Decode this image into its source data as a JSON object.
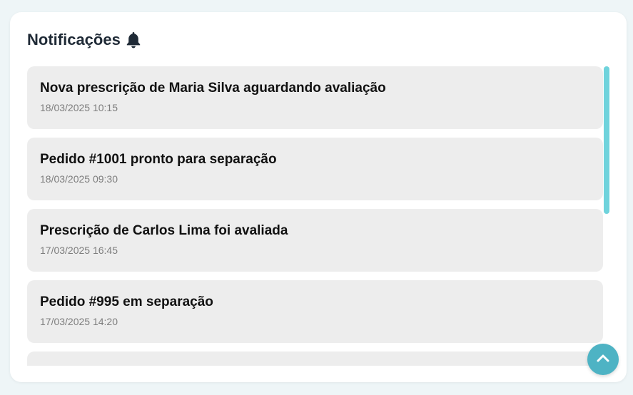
{
  "header": {
    "title": "Notificações",
    "icon": "bell-icon"
  },
  "notifications": [
    {
      "message": "Nova prescrição de Maria Silva aguardando avaliação",
      "timestamp": "18/03/2025 10:15"
    },
    {
      "message": "Pedido #1001 pronto para separação",
      "timestamp": "18/03/2025 09:30"
    },
    {
      "message": "Prescrição de Carlos Lima foi avaliada",
      "timestamp": "17/03/2025 16:45"
    },
    {
      "message": "Pedido #995 em separação",
      "timestamp": "17/03/2025 14:20"
    },
    {
      "message": "",
      "timestamp": ""
    }
  ],
  "scroll_to_top": {
    "icon": "chevron-up-icon"
  },
  "colors": {
    "accent": "#4eb3c4",
    "scrollbar": "#6fd3dc",
    "item_background": "#ededed",
    "page_background": "#eef5f7"
  }
}
